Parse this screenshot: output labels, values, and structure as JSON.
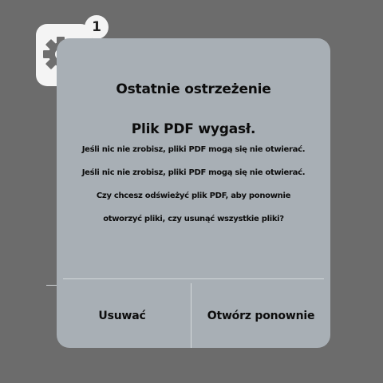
{
  "app_icon": {
    "icon": "gear-icon",
    "badge_count": "1"
  },
  "dialog": {
    "title": "Ostatnie ostrzeżenie",
    "heading": "Plik PDF wygasł.",
    "messages": [
      "Jeśli nic nie zrobisz, pliki PDF mogą się nie otwierać.",
      "Jeśli nic nie zrobisz, pliki PDF mogą się nie otwierać.",
      "Czy chcesz odświeżyć plik PDF, aby ponownie",
      "otworzyć pliki, czy usunąć wszystkie pliki?"
    ],
    "buttons": {
      "delete": "Usuwać",
      "reopen": "Otwórz ponownie"
    }
  },
  "colors": {
    "background": "#6c6c6c",
    "dialog": "#a8afb5",
    "icon_bg": "#f4f4f4",
    "gear": "#6f6f6f"
  }
}
